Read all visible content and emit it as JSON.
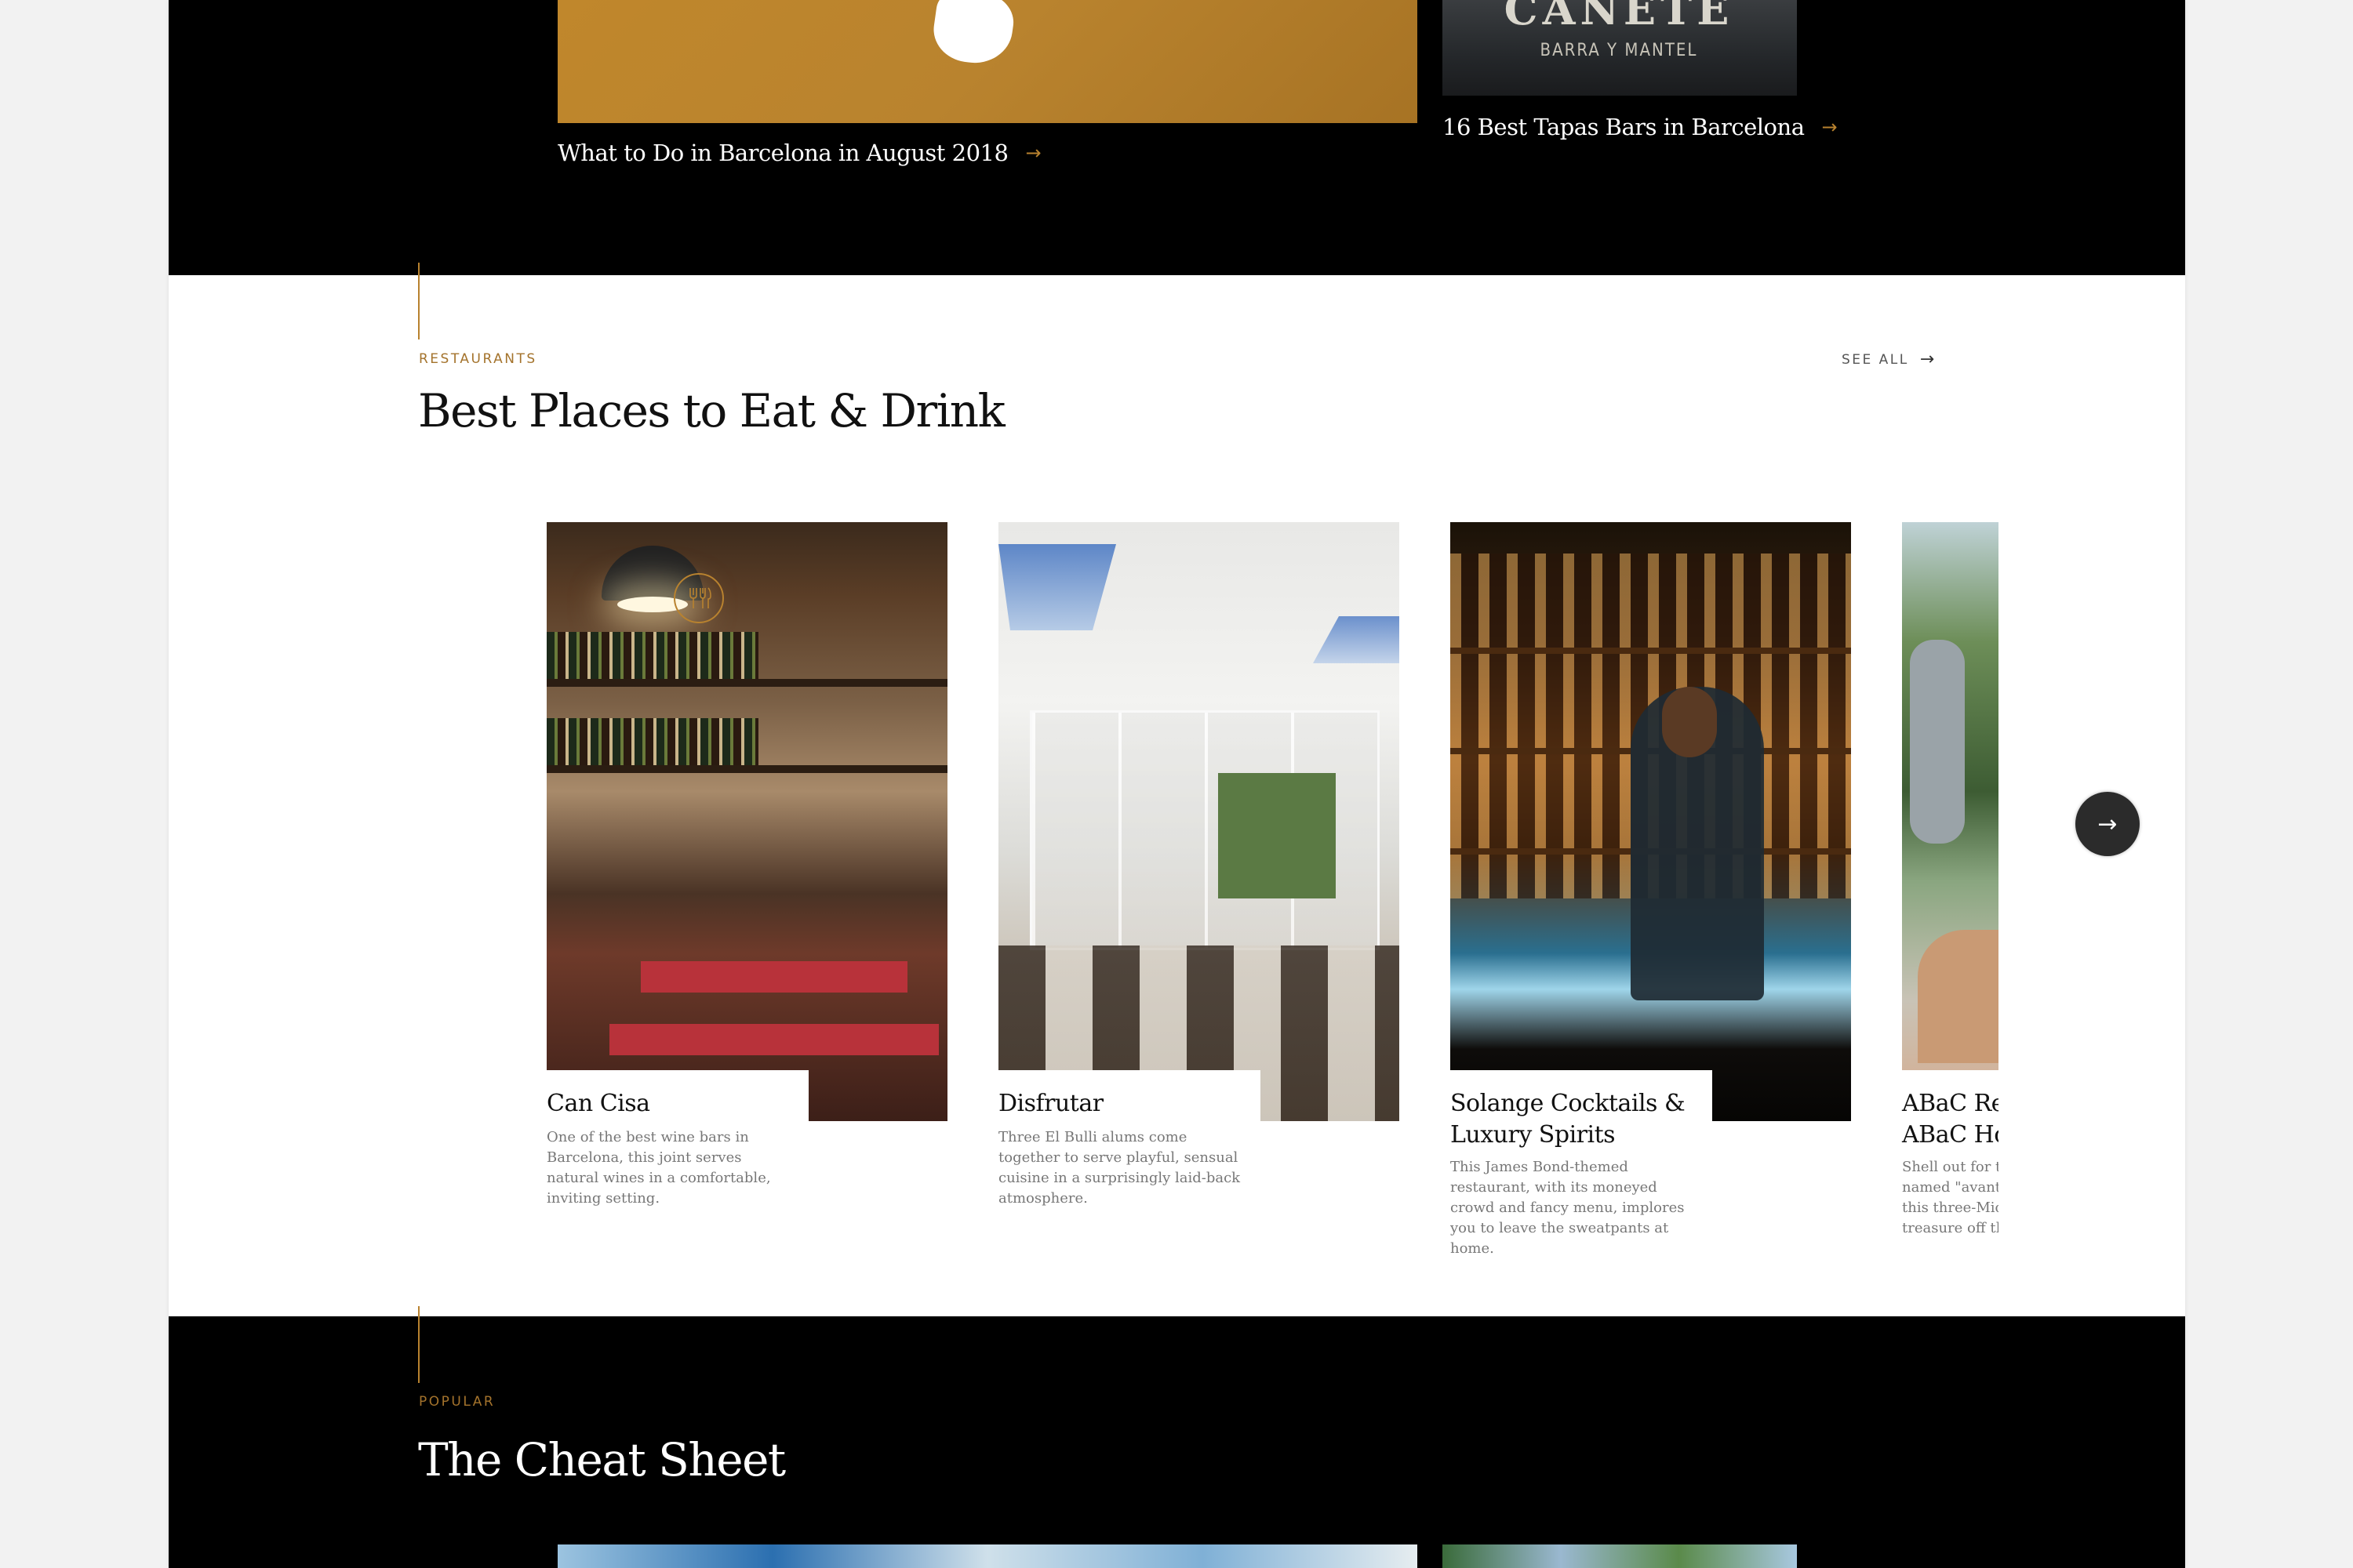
{
  "top": {
    "link1": "What to Do in Barcelona in August 2018",
    "link2": "16 Best Tapas Bars in Barcelona",
    "arrow": "→",
    "sign_text": "CAÑETE",
    "sign_sub": "BARRA Y MANTEL"
  },
  "restaurants": {
    "eyebrow": "RESTAURANTS",
    "title": "Best Places to Eat & Drink",
    "see_all": "SEE ALL",
    "cards": [
      {
        "name": "Can Cisa",
        "desc": "One of the best wine bars in Barcelona, this joint serves natural wines in a comfortable, inviting setting."
      },
      {
        "name": "Disfrutar",
        "desc": "Three El Bulli alums come together to serve playful, sensual cuisine in a surprisingly laid-back atmosphere."
      },
      {
        "name": "Solange Cocktails & Luxury Spirits",
        "desc": "This James Bond-themed restaurant, with its moneyed crowd and fancy menu, implores you to leave the sweatpants at home."
      },
      {
        "name": "ABaC Restaurant & ABaC Hotel",
        "desc": "Shell out for the food at the aptly named \"avant-garde\" creations at this three-Michelin-starred treasure off the beaten path."
      }
    ],
    "next_arrow": "→"
  },
  "popular": {
    "eyebrow": "POPULAR",
    "title": "The Cheat Sheet"
  },
  "colors": {
    "accent": "#b8822f",
    "dark": "#000000"
  },
  "icons": [
    "fork-knife-icon",
    "arrow-right-icon"
  ]
}
